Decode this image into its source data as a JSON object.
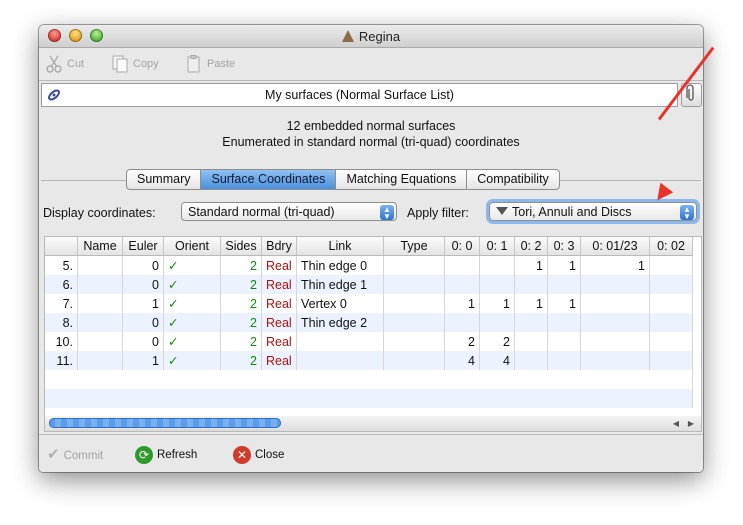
{
  "window": {
    "title": "Regina"
  },
  "toolbar": {
    "cut": "Cut",
    "copy": "Copy",
    "paste": "Paste"
  },
  "packet": {
    "title": "My surfaces (Normal Surface List)"
  },
  "summary": {
    "line1": "12 embedded normal surfaces",
    "line2": "Enumerated in standard normal (tri-quad) coordinates"
  },
  "tabs": [
    "Summary",
    "Surface Coordinates",
    "Matching Equations",
    "Compatibility"
  ],
  "active_tab": "Surface Coordinates",
  "controls": {
    "display_label": "Display coordinates:",
    "display_value": "Standard normal (tri-quad)",
    "filter_label": "Apply filter:",
    "filter_value": "Tori, Annuli and Discs"
  },
  "table": {
    "columns": [
      "",
      "Name",
      "Euler",
      "Orient",
      "Sides",
      "Bdry",
      "Link",
      "Type",
      "0: 0",
      "0: 1",
      "0: 2",
      "0: 3",
      "0: 01/23",
      "0: 02"
    ],
    "rows": [
      [
        "5.",
        "",
        "0",
        "✓",
        "2",
        "Real",
        "Thin edge 0",
        "",
        "",
        "",
        "1",
        "1",
        "1",
        ""
      ],
      [
        "6.",
        "",
        "0",
        "✓",
        "2",
        "Real",
        "Thin edge 1",
        "",
        "",
        "",
        "",
        "",
        "",
        ""
      ],
      [
        "7.",
        "",
        "1",
        "✓",
        "2",
        "Real",
        "Vertex 0",
        "",
        "1",
        "1",
        "1",
        "1",
        "",
        ""
      ],
      [
        "8.",
        "",
        "0",
        "✓",
        "2",
        "Real",
        "Thin edge 2",
        "",
        "",
        "",
        "",
        "",
        "",
        ""
      ],
      [
        "10.",
        "",
        "0",
        "✓",
        "2",
        "Real",
        "",
        "",
        "2",
        "2",
        "",
        "",
        "",
        ""
      ],
      [
        "11.",
        "",
        "1",
        "✓",
        "2",
        "Real",
        "",
        "",
        "4",
        "4",
        "",
        "",
        "",
        ""
      ]
    ]
  },
  "bottom": {
    "commit": "Commit",
    "refresh": "Refresh",
    "close": "Close"
  },
  "colors": {
    "accent": "#4a8fdc",
    "annotation_arrow": "#e8332a",
    "real": "#b01010",
    "check": "#118811"
  }
}
